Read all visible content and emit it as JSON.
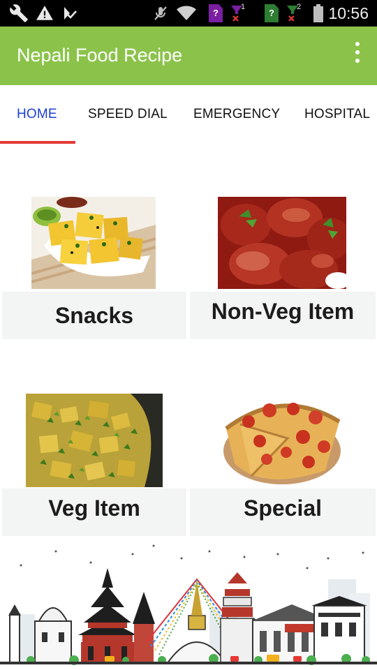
{
  "status_bar": {
    "time": "10:56",
    "sim1_label": "1",
    "sim2_label": "2",
    "unknown_label": "?",
    "icons": [
      "wrench-icon",
      "warning-icon",
      "check-flag-icon",
      "mute-icon",
      "wifi-icon",
      "sim-unknown-icon",
      "signal-off-icon",
      "sim-unknown-icon",
      "signal-off-icon",
      "battery-icon"
    ],
    "colors": {
      "sim1": "#7b1fa2",
      "sim2": "#2e7d32",
      "signal_x": "#e53935"
    }
  },
  "app_bar": {
    "title": "Nepali Food Recipe",
    "background": "#8bc34a",
    "overflow_icon": "more-vert-icon"
  },
  "tabs": {
    "items": [
      {
        "label": "HOME",
        "active": true
      },
      {
        "label": "SPEED DIAL",
        "active": false
      },
      {
        "label": "EMERGENCY",
        "active": false
      },
      {
        "label": "HOSPITAL",
        "active": false
      }
    ],
    "active_color": "#1a3fd1",
    "indicator_color": "#e53935"
  },
  "categories": [
    {
      "label": "Snacks",
      "image": "dhokla-snack-photo"
    },
    {
      "label": "Non-Veg Item",
      "image": "meat-curry-photo"
    },
    {
      "label": "Veg Item",
      "image": "potato-curry-photo"
    },
    {
      "label": "Special",
      "image": "pizza-photo"
    }
  ],
  "footer": {
    "image": "kathmandu-skyline-illustration"
  }
}
